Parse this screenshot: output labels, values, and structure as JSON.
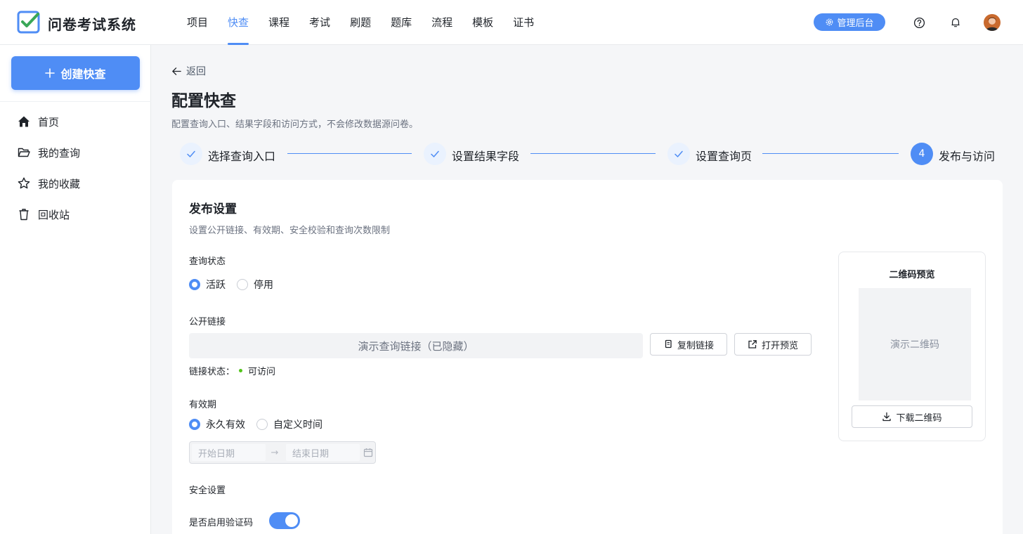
{
  "app": {
    "title": "问卷考试系统"
  },
  "nav": {
    "items": [
      "项目",
      "快查",
      "课程",
      "考试",
      "刷题",
      "题库",
      "流程",
      "模板",
      "证书"
    ],
    "active_index": 1
  },
  "header": {
    "admin_label": "管理后台"
  },
  "sidebar": {
    "create_label": "创建快查",
    "items": [
      {
        "label": "首页",
        "icon": "home-icon"
      },
      {
        "label": "我的查询",
        "icon": "folder-open-icon"
      },
      {
        "label": "我的收藏",
        "icon": "star-icon"
      },
      {
        "label": "回收站",
        "icon": "trash-icon"
      }
    ]
  },
  "page": {
    "back_label": "返回",
    "title": "配置快查",
    "subtitle": "配置查询入口、结果字段和访问方式，不会修改数据源问卷。"
  },
  "steps": [
    {
      "label": "选择查询入口",
      "status": "done"
    },
    {
      "label": "设置结果字段",
      "status": "done"
    },
    {
      "label": "设置查询页",
      "status": "done"
    },
    {
      "label": "发布与访问",
      "status": "current",
      "number": "4"
    }
  ],
  "publish": {
    "title": "发布设置",
    "subtitle": "设置公开链接、有效期、安全校验和查询次数限制",
    "status": {
      "label": "查询状态",
      "options": [
        "活跃",
        "停用"
      ],
      "selected": 0
    },
    "link": {
      "label": "公开链接",
      "value": "演示查询链接（已隐藏）",
      "copy_label": "复制链接",
      "preview_label": "打开预览",
      "status_label": "链接状态：",
      "status_value": "可访问"
    },
    "validity": {
      "label": "有效期",
      "options": [
        "永久有效",
        "自定义时间"
      ],
      "selected": 0,
      "start_placeholder": "开始日期",
      "end_placeholder": "结束日期"
    },
    "security": {
      "label": "安全设置",
      "captcha_label": "是否启用验证码",
      "captcha_enabled": true
    }
  },
  "qr": {
    "title": "二维码预览",
    "placeholder": "演示二维码",
    "download_label": "下载二维码"
  },
  "colors": {
    "accent": "#4f8df5",
    "success": "#52c41a",
    "background": "#f5f6f8"
  }
}
